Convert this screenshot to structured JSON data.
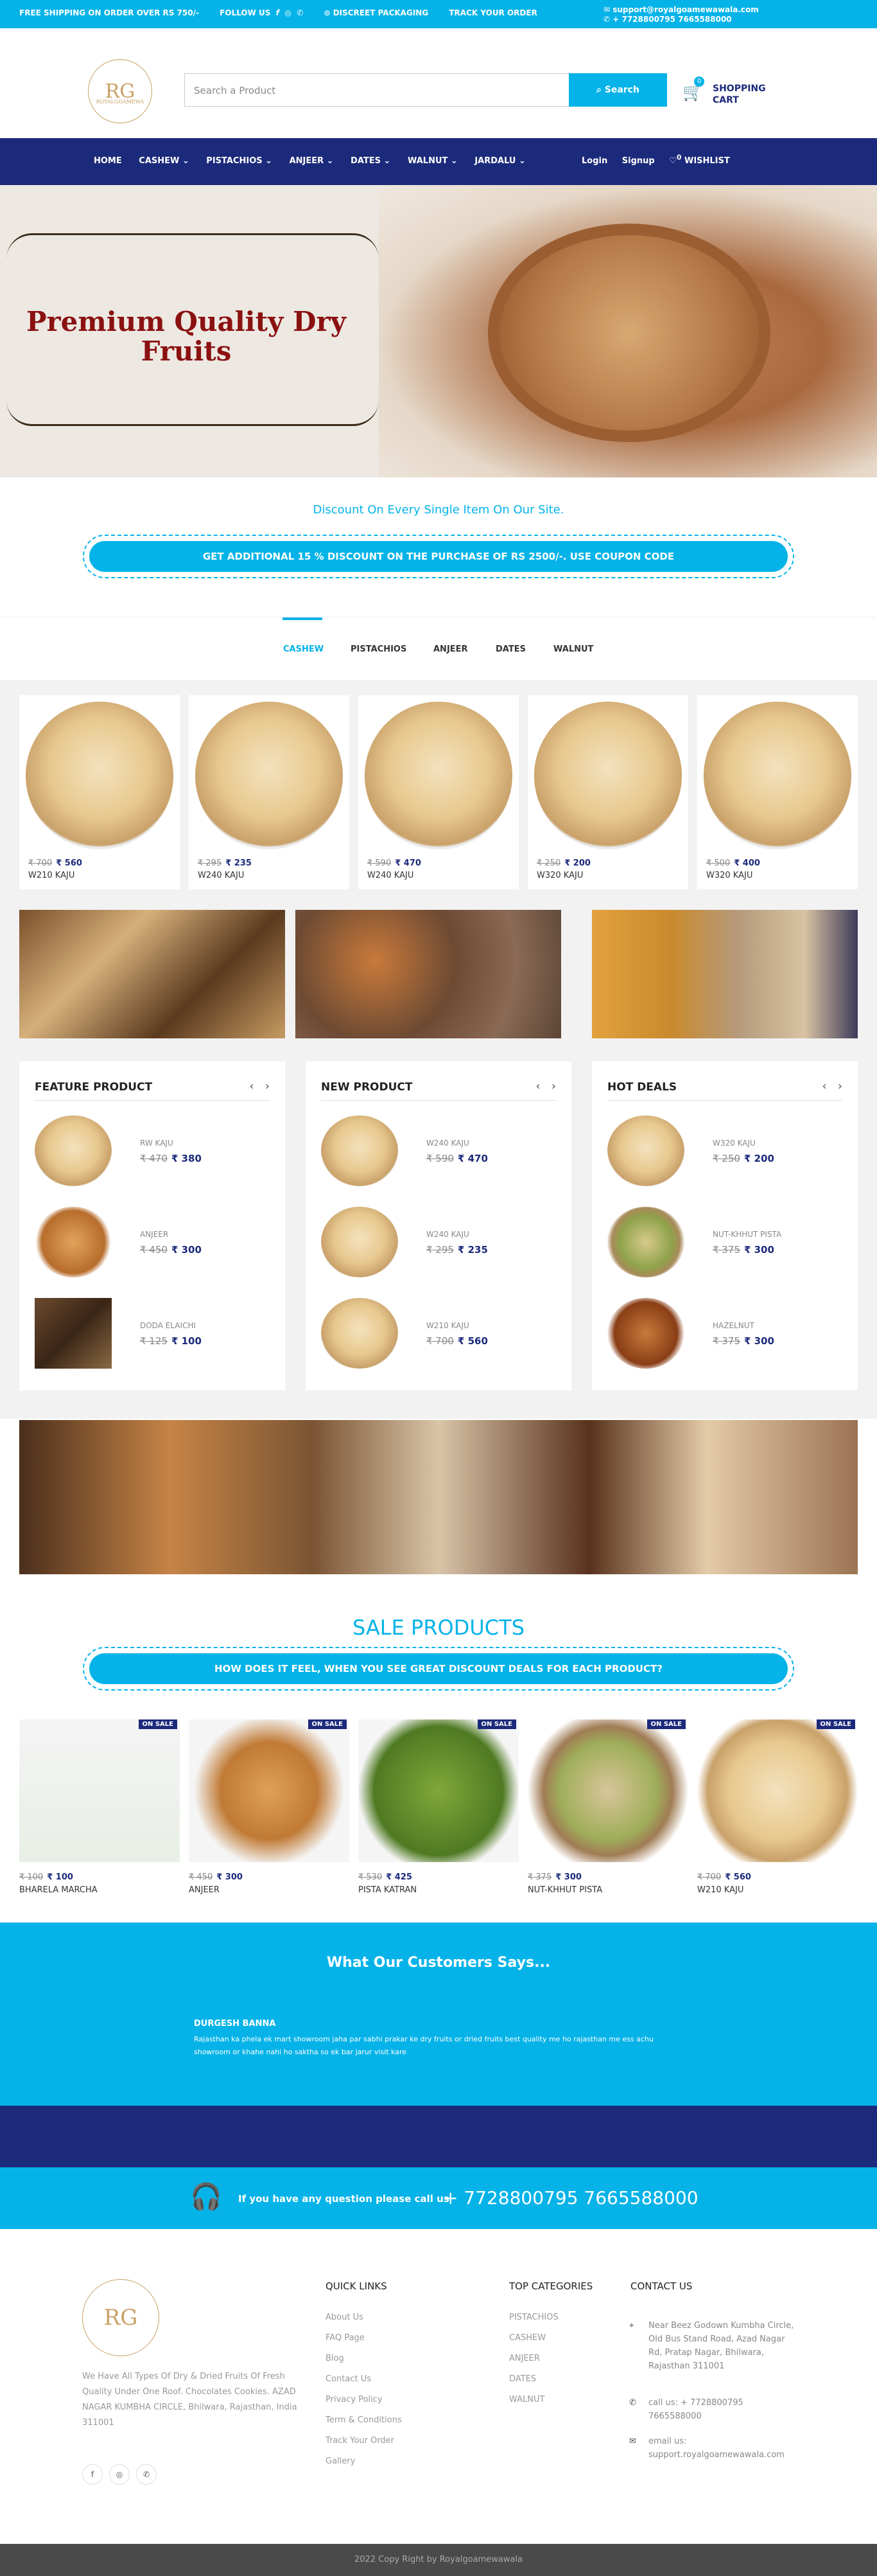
{
  "topbar": {
    "free_shipping": "FREE SHIPPING ON ORDER OVER RS 750/-",
    "follow_us": "FOLLOW US",
    "discreet": "DISCREET PACKAGING",
    "track": "TRACK YOUR ORDER",
    "email": "support@royalgoamewawala.com",
    "phone": "+ 7728800795 7665588000"
  },
  "header": {
    "logo_text": "RG",
    "logo_sub": "ROYALGOAMEWA",
    "search_placeholder": "Search a Product",
    "search_button": "Search",
    "cart_count": "0",
    "cart_label": "SHOPPING CART"
  },
  "nav": {
    "items": [
      "HOME",
      "CASHEW ⌄",
      "PISTACHIOS ⌄",
      "ANJEER ⌄",
      "DATES ⌄",
      "WALNUT ⌄",
      "JARDALU ⌄"
    ],
    "login": "Login",
    "signup": "Signup",
    "wishlist": "WISHLIST",
    "wishlist_count": "0"
  },
  "hero": {
    "title": "Premium Quality Dry Fruits"
  },
  "promo": {
    "discount_text": "Discount On Every Single Item On Our Site.",
    "coupon": "GET ADDITIONAL 15 % DISCOUNT ON THE PURCHASE OF RS 2500/-. USE COUPON CODE"
  },
  "tabs": [
    "CASHEW",
    "PISTACHIOS",
    "ANJEER",
    "DATES",
    "WALNUT"
  ],
  "products": [
    {
      "old": "₹ 700",
      "new": "₹ 560",
      "name": "W210 KAJU"
    },
    {
      "old": "₹ 295",
      "new": "₹ 235",
      "name": "W240 KAJU"
    },
    {
      "old": "₹ 590",
      "new": "₹ 470",
      "name": "W240 KAJU"
    },
    {
      "old": "₹ 250",
      "new": "₹ 200",
      "name": "W320 KAJU"
    },
    {
      "old": "₹ 500",
      "new": "₹ 400",
      "name": "W320 KAJU"
    }
  ],
  "feature": {
    "title": "FEATURE PRODUCT",
    "items": [
      {
        "name": "RW KAJU",
        "old": "₹ 470",
        "new": "₹ 380"
      },
      {
        "name": "ANJEER",
        "old": "₹ 450",
        "new": "₹ 300"
      },
      {
        "name": "DODA ELAICHI",
        "old": "₹ 125",
        "new": "₹ 100"
      }
    ]
  },
  "newp": {
    "title": "NEW PRODUCT",
    "items": [
      {
        "name": "W240 KAJU",
        "old": "₹ 590",
        "new": "₹ 470"
      },
      {
        "name": "W240 KAJU",
        "old": "₹ 295",
        "new": "₹ 235"
      },
      {
        "name": "W210 KAJU",
        "old": "₹ 700",
        "new": "₹ 560"
      }
    ]
  },
  "hot": {
    "title": "HOT DEALS",
    "items": [
      {
        "name": "W320 KAJU",
        "old": "₹ 250",
        "new": "₹ 200"
      },
      {
        "name": "NUT-KHHUT PISTA",
        "old": "₹ 375",
        "new": "₹ 300"
      },
      {
        "name": "HAZELNUT",
        "old": "₹ 375",
        "new": "₹ 300"
      }
    ]
  },
  "sale": {
    "heading": "SALE PRODUCTS",
    "question": "HOW DOES IT FEEL, WHEN YOU SEE GREAT DISCOUNT DEALS FOR EACH PRODUCT?",
    "badge": "ON SALE",
    "items": [
      {
        "old": "₹ 100",
        "new": "₹ 100",
        "name": "BHARELA MARCHA"
      },
      {
        "old": "₹ 450",
        "new": "₹ 300",
        "name": "ANJEER"
      },
      {
        "old": "₹ 530",
        "new": "₹ 425",
        "name": "PISTA KATRAN"
      },
      {
        "old": "₹ 375",
        "new": "₹ 300",
        "name": "NUT-KHHUT PISTA"
      },
      {
        "old": "₹ 700",
        "new": "₹ 560",
        "name": "W210 KAJU"
      }
    ]
  },
  "testimonial": {
    "heading": "What Our Customers Says...",
    "name": "DURGESH BANNA",
    "text": "Rajasthan ka phela ek mart showroom jaha par sabhi prakar ke dry fruits or dried fruits best quality me ho rajasthan me ess achu showroom or khahe nahi ho saktha so ek bar jarur visit kare"
  },
  "callband": {
    "question": "If you have any question please call us",
    "phone": "+ 7728800795 7665588000"
  },
  "footer": {
    "desc": "We Have All Types Of Dry & Dried Fruits Of Fresh Quality Under One Roof. Chocolates Cookies. AZAD NAGAR KUMBHA CIRCLE, Bhilwara, Rajasthan, India 311001",
    "quick_title": "QUICK LINKS",
    "quick": [
      "About Us",
      "FAQ Page",
      "Blog",
      "Contact Us",
      "Privacy Policy",
      "Term & Conditions",
      "Track Your Order",
      "Gallery"
    ],
    "cat_title": "TOP CATEGORIES",
    "cats": [
      "PISTACHIOS",
      "CASHEW",
      "ANJEER",
      "DATES",
      "WALNUT"
    ],
    "contact_title": "CONTACT US",
    "address": "Near Beez Godown Kumbha Circle, Old Bus Stand Road, Azad Nagar Rd, Pratap Nagar, Bhilwara, Rajasthan 311001",
    "call_label": "call us:",
    "call": "+ 7728800795 7665588000",
    "email_label": "email us:",
    "email": "support.royalgoamewawala.com",
    "copyright": "2022 Copy Right by Royalgoamewawala"
  },
  "colors": {
    "primary": "#05b3e8",
    "navy": "#1c2a7b"
  }
}
